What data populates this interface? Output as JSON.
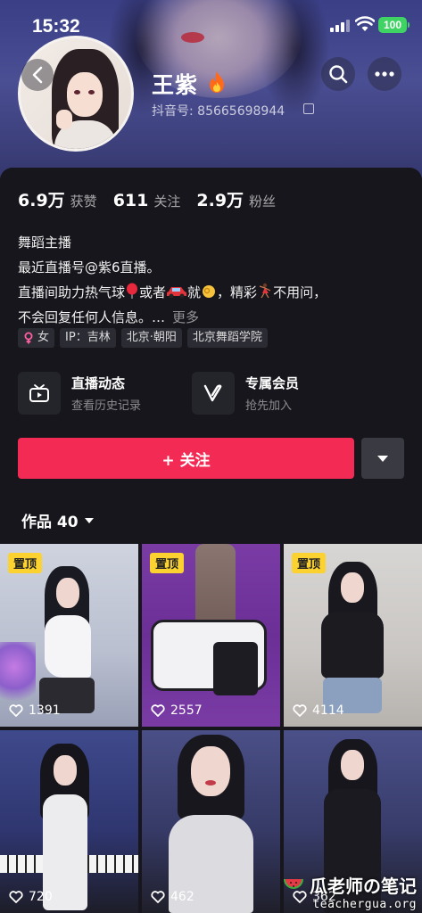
{
  "status_bar": {
    "time": "15:32",
    "battery": "100"
  },
  "profile": {
    "name": "王紫",
    "account_id": "抖音号: 85665698944"
  },
  "stats": [
    {
      "value": "6.9万",
      "label": "获赞"
    },
    {
      "value": "611",
      "label": "关注"
    },
    {
      "value": "2.9万",
      "label": "粉丝"
    }
  ],
  "bio": {
    "line1": "舞蹈主播",
    "line2": "最近直播号@紫6直播。",
    "line3_a": "直播间助力热气球",
    "line3_b": "或者",
    "line3_c": "就",
    "line3_d": "，精彩",
    "line3_e": "不用问，",
    "line4": "不会回复任何人信息。…",
    "more": "更多"
  },
  "tags": [
    {
      "icon": "female-icon",
      "label": "女"
    },
    {
      "label": "IP：吉林"
    },
    {
      "label": "北京·朝阳"
    },
    {
      "label": "北京舞蹈学院"
    }
  ],
  "features": [
    {
      "icon": "tv-icon",
      "title": "直播动态",
      "subtitle": "查看历史记录"
    },
    {
      "icon": "v-icon",
      "title": "专属会员",
      "subtitle": "抢先加入"
    }
  ],
  "follow_button": "+ 关注",
  "works_tab": {
    "label": "作品 40"
  },
  "videos": [
    {
      "pinned": "置顶",
      "likes": "1391"
    },
    {
      "pinned": "置顶",
      "likes": "2557"
    },
    {
      "pinned": "置顶",
      "likes": "4114"
    },
    {
      "likes": "720"
    },
    {
      "likes": "462"
    },
    {
      "likes": "362"
    }
  ],
  "watermark": {
    "title": "瓜老师の笔记",
    "url": "teachergua.org"
  },
  "colors": {
    "accent": "#f32a54",
    "pin_badge": "#fbd22f",
    "battery": "#3fd364"
  }
}
